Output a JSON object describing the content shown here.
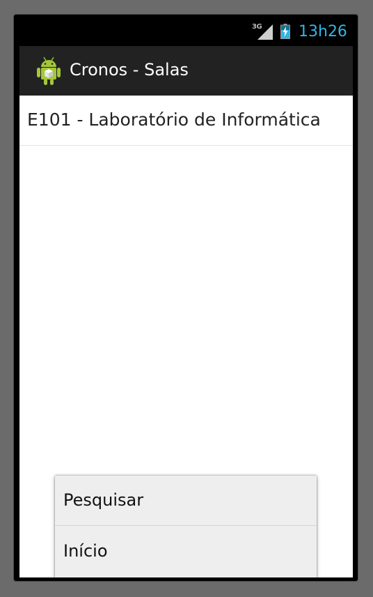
{
  "status_bar": {
    "network_label": "3G",
    "time": "13h26",
    "time_color": "#33b5e5",
    "icons": [
      "3g-signal-icon",
      "battery-charging-icon"
    ]
  },
  "action_bar": {
    "title": "Cronos - Salas",
    "icon": "android-app-icon",
    "background_color": "#222222"
  },
  "list": {
    "items": [
      {
        "label": "E101 - Laboratório de Informática"
      }
    ]
  },
  "options_menu": {
    "items": [
      {
        "label": "Pesquisar"
      },
      {
        "label": "Início"
      }
    ]
  }
}
